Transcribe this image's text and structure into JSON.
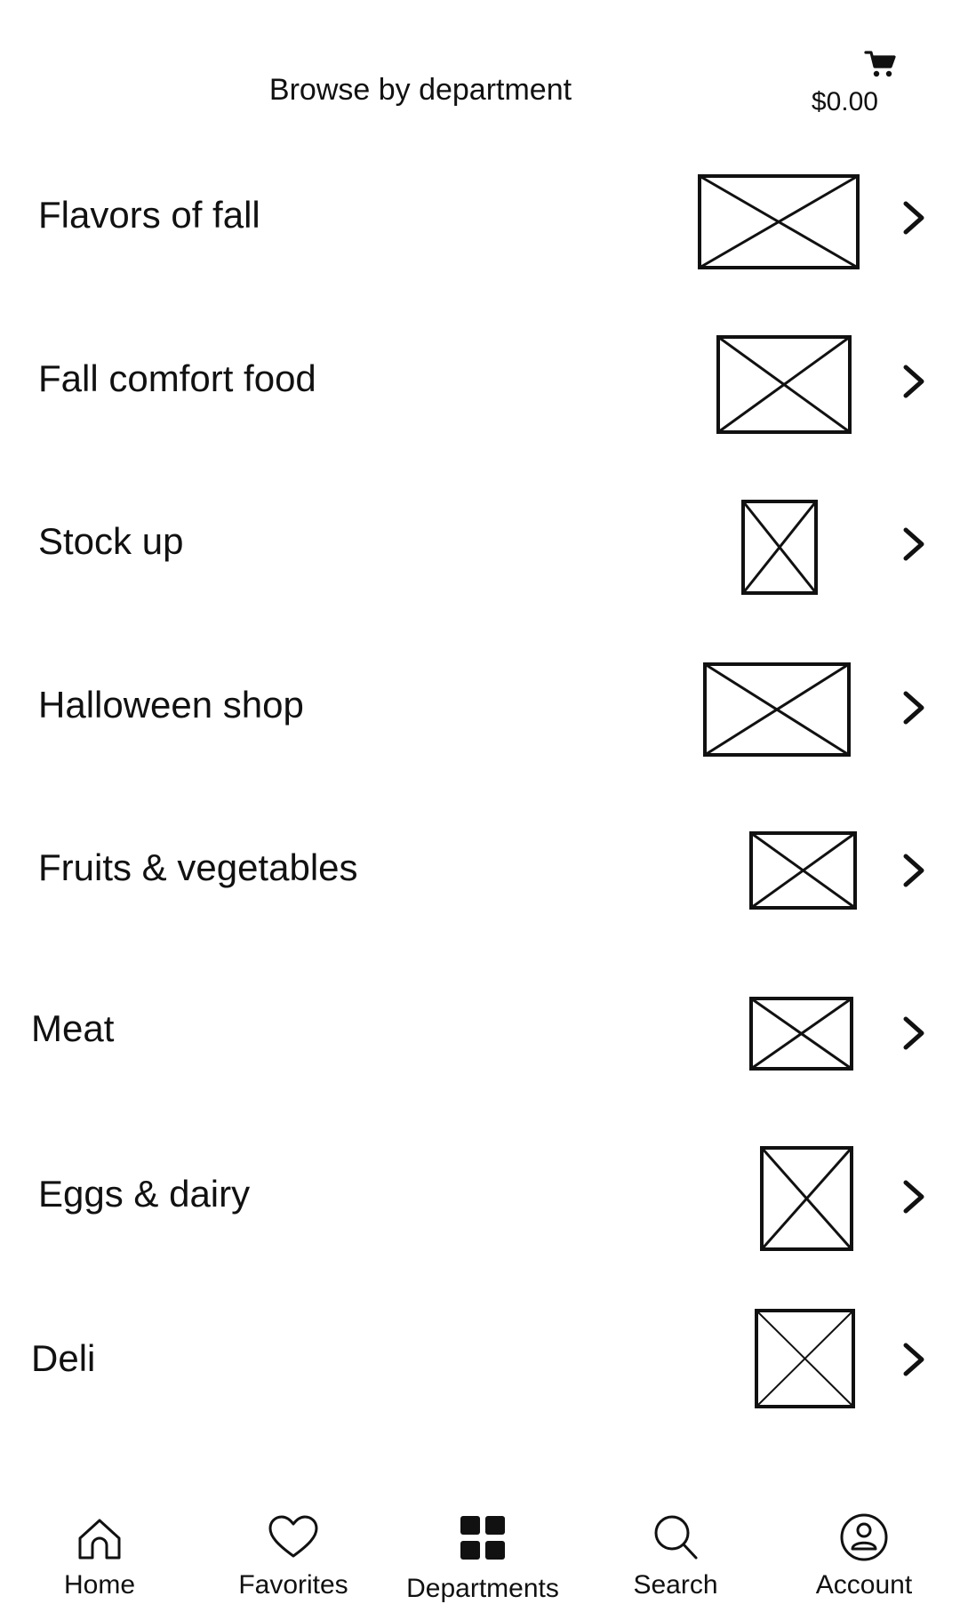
{
  "header": {
    "title": "Browse by department",
    "cart_total": "$0.00",
    "cart_icon": "shopping-cart-icon"
  },
  "departments": [
    {
      "label": "Flavors of fall",
      "thumb_icon": "image-placeholder-icon",
      "chevron_icon": "chevron-right-icon"
    },
    {
      "label": "Fall comfort food",
      "thumb_icon": "image-placeholder-icon",
      "chevron_icon": "chevron-right-icon"
    },
    {
      "label": "Stock up",
      "thumb_icon": "image-placeholder-icon",
      "chevron_icon": "chevron-right-icon"
    },
    {
      "label": "Halloween shop",
      "thumb_icon": "image-placeholder-icon",
      "chevron_icon": "chevron-right-icon"
    },
    {
      "label": "Fruits & vegetables",
      "thumb_icon": "image-placeholder-icon",
      "chevron_icon": "chevron-right-icon"
    },
    {
      "label": "Meat",
      "thumb_icon": "image-placeholder-icon",
      "chevron_icon": "chevron-right-icon"
    },
    {
      "label": "Eggs & dairy",
      "thumb_icon": "image-placeholder-icon",
      "chevron_icon": "chevron-right-icon"
    },
    {
      "label": "Deli",
      "thumb_icon": "image-placeholder-icon",
      "chevron_icon": "chevron-right-icon"
    }
  ],
  "tabbar": {
    "active": "Departments",
    "tabs": [
      {
        "label": "Home",
        "icon": "home-icon"
      },
      {
        "label": "Favorites",
        "icon": "heart-icon"
      },
      {
        "label": "Departments",
        "icon": "grid-icon"
      },
      {
        "label": "Search",
        "icon": "search-icon"
      },
      {
        "label": "Account",
        "icon": "account-icon"
      }
    ]
  },
  "colors": {
    "background": "#ffffff",
    "text": "#111111",
    "stroke": "#111111"
  }
}
